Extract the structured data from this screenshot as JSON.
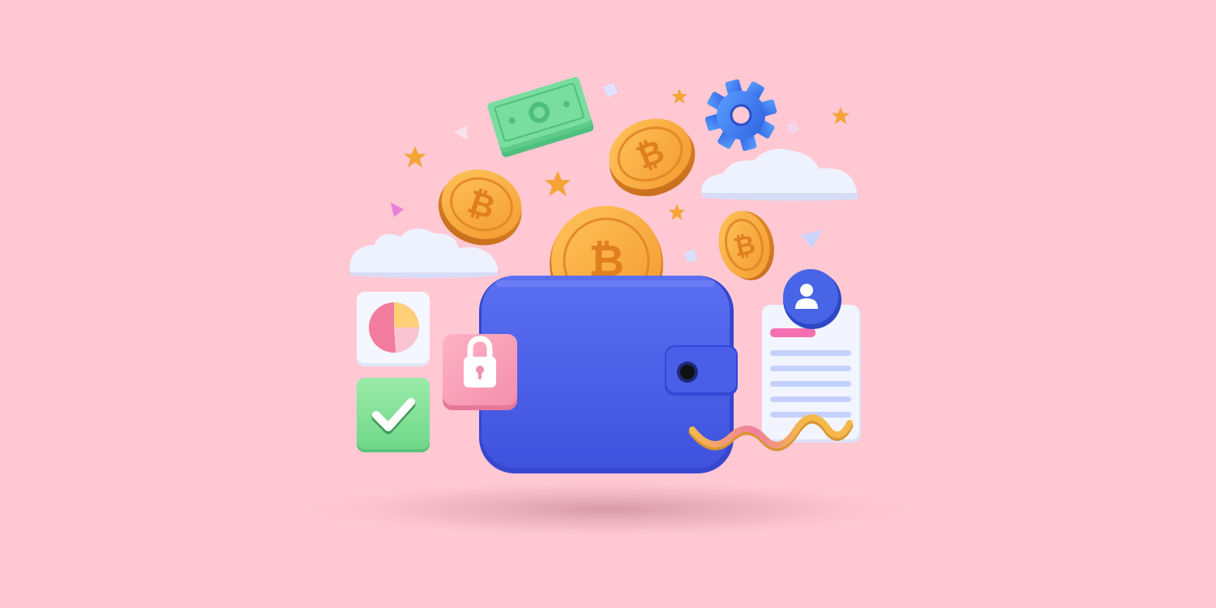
{
  "scene": {
    "background": "#FFC8D3",
    "wallet_color": "#4A5FE8",
    "coin_color": "#F7A93A",
    "coin_glyph": "₿",
    "cloud_color": "#EEF2FF",
    "lock_tile_color": "#F9A0B8",
    "check_tile_color": "#8EE59C",
    "star_color": "#F5A436",
    "gear_color": "#3F7BF0",
    "banknote_color": "#72D69A",
    "avatar_badge_color": "#3F63E0",
    "document_highlight_color": "#F56FB0",
    "wave_colors": [
      "#F2B64A",
      "#F0749C"
    ]
  },
  "icons": [
    "wallet-icon",
    "bitcoin-coin-icon",
    "banknote-icon",
    "gear-icon",
    "star-icon",
    "cloud-icon",
    "pie-chart-icon",
    "checkmark-icon",
    "padlock-icon",
    "user-avatar-icon",
    "document-icon",
    "wave-line"
  ]
}
